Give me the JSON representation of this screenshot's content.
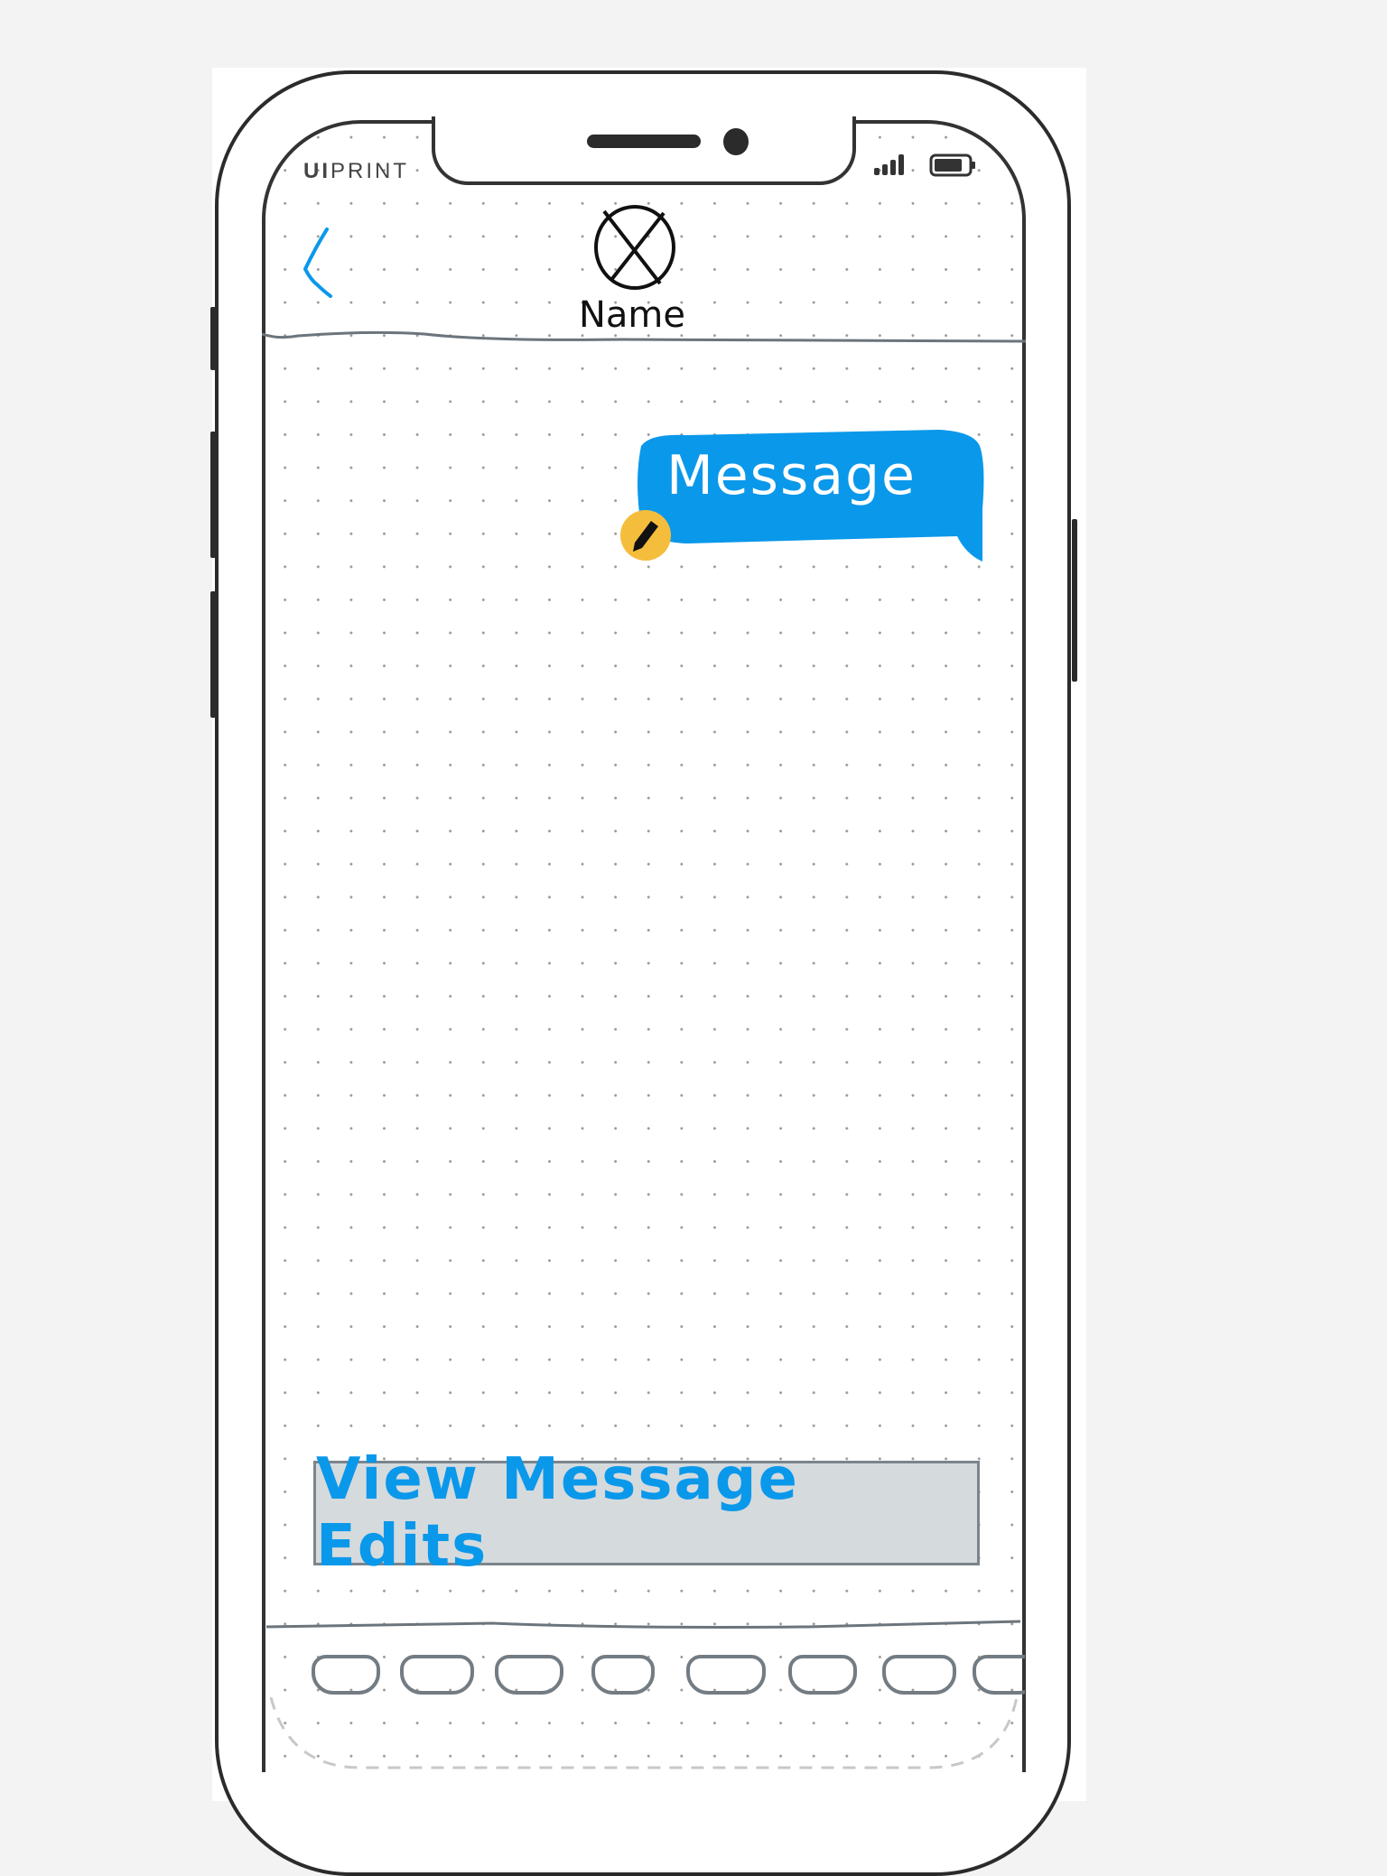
{
  "status_bar": {
    "brand_bold": "UI",
    "brand_rest": "PRINT",
    "signal_icon": "signal-icon",
    "battery_icon": "battery-icon"
  },
  "header": {
    "back_icon": "chevron-left-icon",
    "avatar_icon": "avatar-placeholder-icon",
    "contact_name": "Name"
  },
  "conversation": {
    "messages": [
      {
        "text": "Message",
        "edited": true,
        "edit_icon": "pencil-icon"
      }
    ]
  },
  "actions": {
    "view_edits_label": "View Message Edits"
  },
  "colors": {
    "accent": "#0a98ea",
    "bubble": "#0a98ea",
    "badge": "#f5bd3c",
    "button_bg": "#d5dadd"
  },
  "keyboard": {
    "key_count": 8
  }
}
